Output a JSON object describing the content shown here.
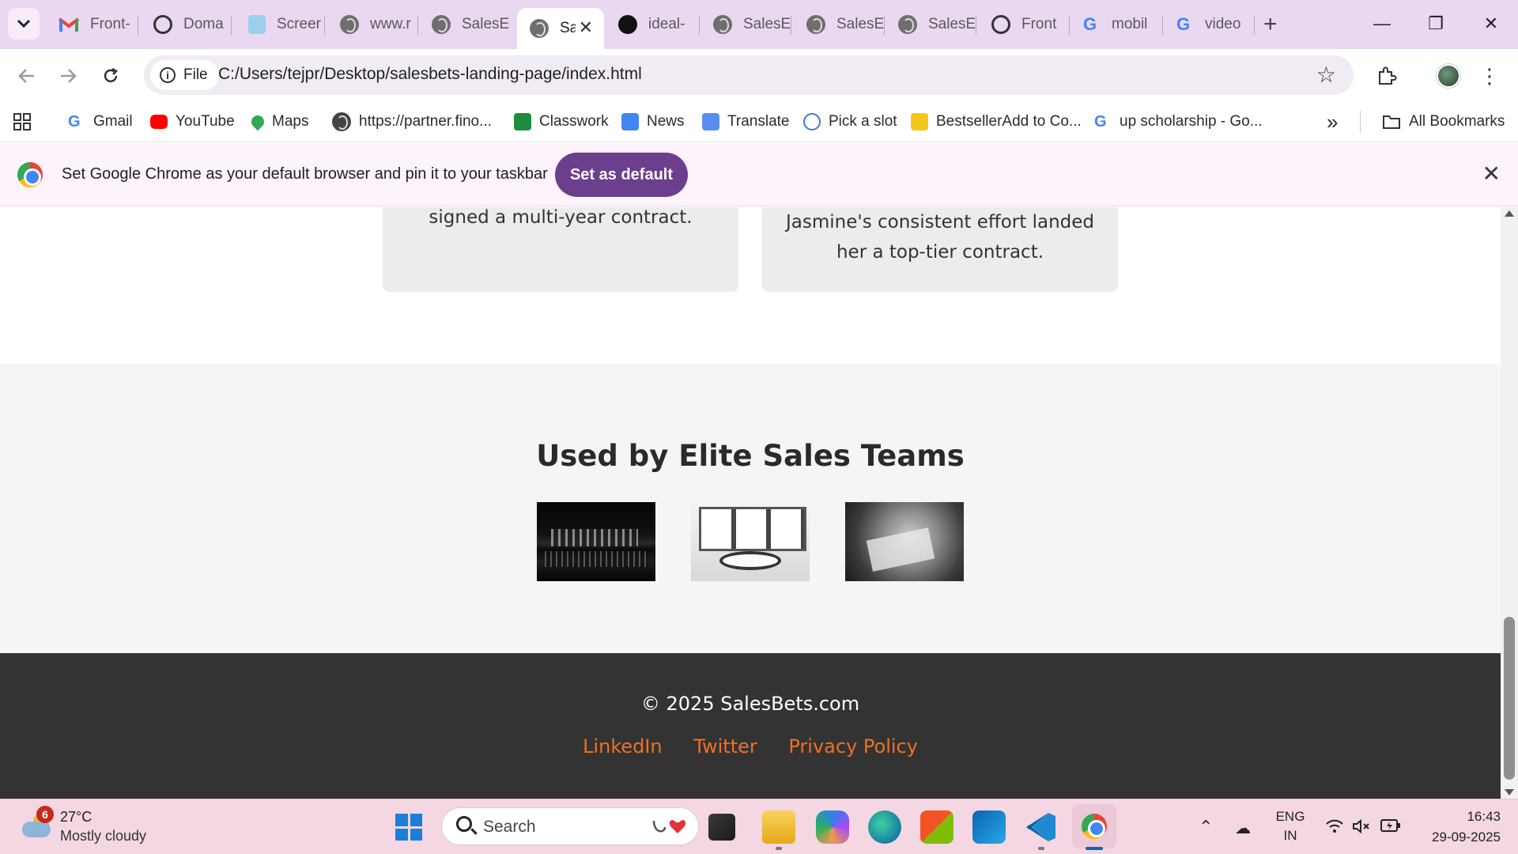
{
  "browser": {
    "tabs": [
      {
        "label": "Front-",
        "icon": "gmail-icon"
      },
      {
        "label": "Doma",
        "icon": "openai-icon"
      },
      {
        "label": "Screer",
        "icon": "document-icon"
      },
      {
        "label": "www.r",
        "icon": "globe-icon"
      },
      {
        "label": "SalesE",
        "icon": "globe-icon"
      },
      {
        "label": "Sa",
        "icon": "globe-icon",
        "active": true
      },
      {
        "label": "ideal-",
        "icon": "github-icon"
      },
      {
        "label": "SalesE",
        "icon": "globe-icon"
      },
      {
        "label": "SalesE",
        "icon": "globe-icon"
      },
      {
        "label": "SalesE",
        "icon": "globe-icon"
      },
      {
        "label": "Front",
        "icon": "openai-icon"
      },
      {
        "label": "mobil",
        "icon": "google-icon"
      },
      {
        "label": "video",
        "icon": "google-icon"
      }
    ],
    "new_tab_symbol": "+",
    "close_tab_symbol": "✕",
    "window_controls": {
      "minimize": "—",
      "restore": "❐",
      "close": "✕"
    },
    "site_chip_label": "File",
    "url": "C:/Users/tejpr/Desktop/salesbets-landing-page/index.html",
    "bookmarks": [
      {
        "label": "Gmail",
        "icon": "google-icon"
      },
      {
        "label": "YouTube",
        "icon": "youtube-icon"
      },
      {
        "label": "Maps",
        "icon": "maps-icon"
      },
      {
        "label": "https://partner.fino...",
        "icon": "globe-icon"
      },
      {
        "label": "Classwork",
        "icon": "classroom-icon"
      },
      {
        "label": "News",
        "icon": "news-icon"
      },
      {
        "label": "Translate",
        "icon": "translate-icon"
      },
      {
        "label": "Pick a slot",
        "icon": "slot-icon"
      },
      {
        "label": "BestsellerAdd to Co...",
        "icon": "bestseller-icon"
      },
      {
        "label": "up scholarship - Go...",
        "icon": "google-icon"
      }
    ],
    "more_bookmarks_symbol": "»",
    "all_bookmarks_label": "All Bookmarks",
    "infobar": {
      "message": "Set Google Chrome as your default browser and pin it to your taskbar",
      "button_label": "Set as default",
      "close_symbol": "✕"
    }
  },
  "page": {
    "cards": [
      {
        "lines": [
          "signed a multi-year contract."
        ]
      },
      {
        "lines": [
          "Jasmine's consistent effort landed",
          "her a top-tier contract."
        ]
      }
    ],
    "teams_section": {
      "title": "Used by Elite Sales Teams",
      "images": [
        {
          "name": "city-night-image"
        },
        {
          "name": "conference-room-image"
        },
        {
          "name": "meeting-hands-image"
        }
      ]
    },
    "footer": {
      "copyright": "© 2025 SalesBets.com",
      "links": [
        "LinkedIn",
        "Twitter",
        "Privacy Policy"
      ],
      "link_color": "#f07020"
    }
  },
  "taskbar": {
    "weather": {
      "badge": "6",
      "temp": "27°C",
      "desc": "Mostly cloudy"
    },
    "search_placeholder": "Search",
    "apps": [
      "task-view",
      "file-explorer",
      "copilot",
      "edge",
      "store",
      "outlook",
      "vscode",
      "chrome"
    ],
    "language": {
      "line1": "ENG",
      "line2": "IN"
    },
    "clock": {
      "time": "16:43",
      "date": "29-09-2025"
    }
  },
  "colors": {
    "tabstrip": "#e9d8f0",
    "set_default_button": "#6b3f8e",
    "footer_bg": "#333333",
    "taskbar": "#f4d7e3"
  }
}
